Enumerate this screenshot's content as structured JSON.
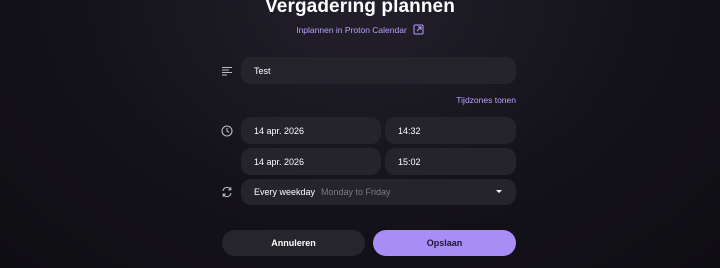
{
  "header": {
    "title": "Vergadering plannen",
    "schedule_link": "Inplannen in Proton Calendar"
  },
  "form": {
    "title_value": "Test",
    "timezones_link": "Tijdzones tonen",
    "start_date": "14 apr. 2026",
    "start_time": "14:32",
    "end_date": "14 apr. 2026",
    "end_time": "15:02",
    "recurrence_value": "Every weekday",
    "recurrence_detail": "Monday to Friday"
  },
  "actions": {
    "cancel_label": "Annuleren",
    "save_label": "Opslaan"
  },
  "icons": {
    "title_row": "text-lines-icon",
    "time_row": "clock-icon",
    "recurrence_row": "repeat-icon",
    "external_link": "external-link-icon",
    "dropdown": "caret-down-icon"
  },
  "colors": {
    "accent": "#a98cf5",
    "link": "#b7a2ff",
    "field_bg": "#25232b",
    "background": "#141219"
  }
}
